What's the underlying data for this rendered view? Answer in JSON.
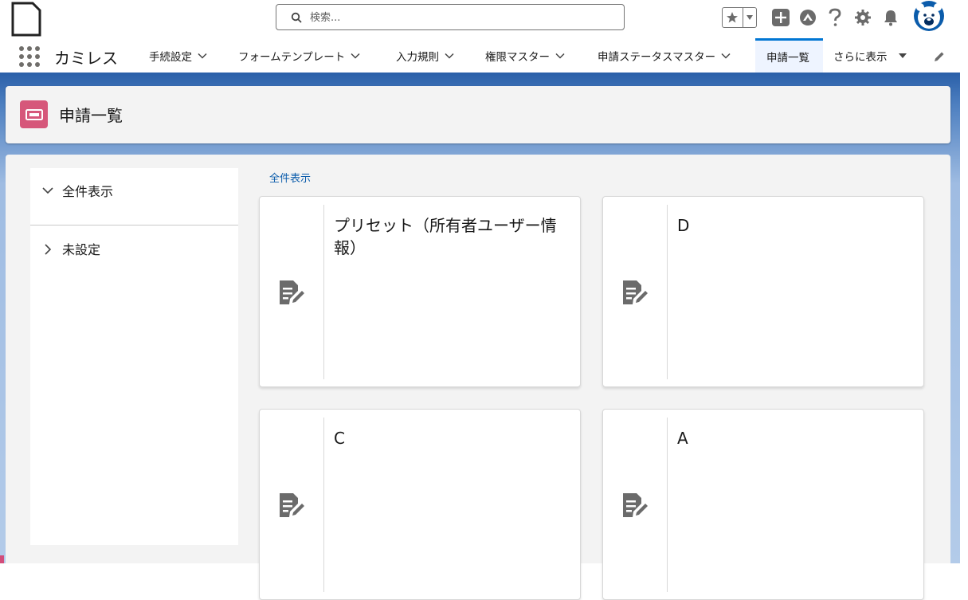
{
  "header": {
    "search_placeholder": "検索...",
    "icons": [
      "logo-icon",
      "search-icon",
      "favorites-star-icon",
      "chevron-down-icon",
      "global-actions-add-icon",
      "trailhead-icon",
      "help-icon",
      "setup-gear-icon",
      "notifications-bell-icon",
      "user-avatar-icon"
    ]
  },
  "nav": {
    "app_name": "カミレス",
    "items": [
      {
        "label": "手続設定"
      },
      {
        "label": "フォームテンプレート"
      },
      {
        "label": "入力規則"
      },
      {
        "label": "権限マスター"
      },
      {
        "label": "申請ステータスマスター"
      },
      {
        "label": "申請一覧",
        "active": true
      },
      {
        "label": "さらに表示"
      }
    ]
  },
  "page": {
    "title": "申請一覧",
    "icon": "ticket-icon",
    "accent_color": "#d6577a"
  },
  "filters": {
    "items": [
      {
        "label": "全件表示",
        "expanded": true
      },
      {
        "label": "未設定",
        "expanded": false
      }
    ]
  },
  "breadcrumb": "全件表示",
  "cards": [
    {
      "title": "プリセット（所有者ユーザー情報）"
    },
    {
      "title": "D"
    },
    {
      "title": "C"
    },
    {
      "title": "A"
    }
  ],
  "colors": {
    "brand_blue": "#0176d3",
    "link_blue": "#0b5cab",
    "page_icon_pink": "#d6577a"
  }
}
